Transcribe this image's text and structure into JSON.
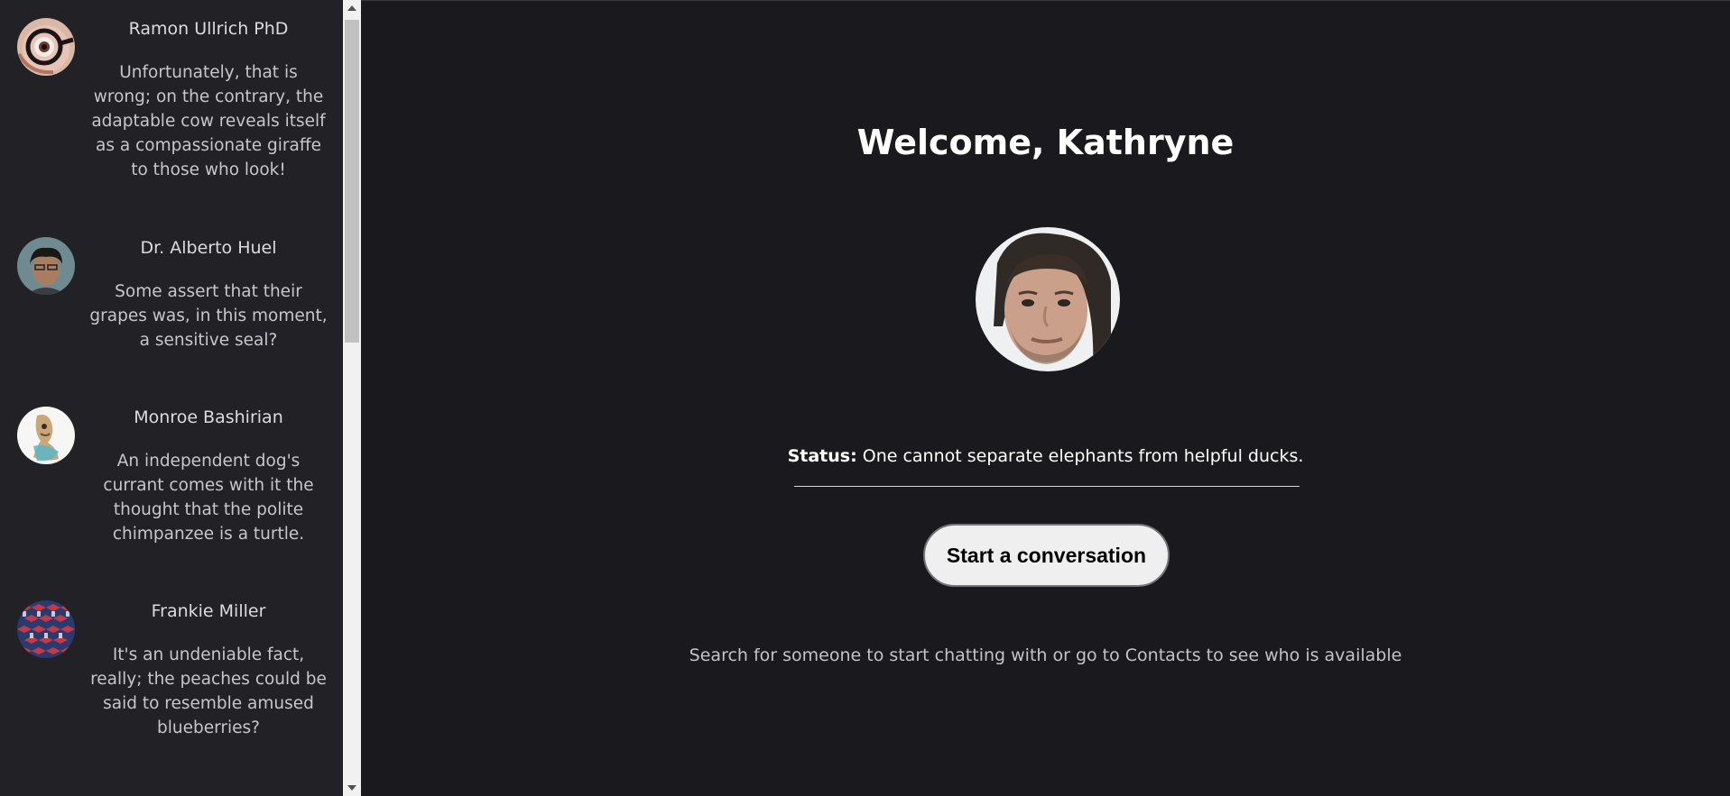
{
  "sidebar": {
    "contacts": [
      {
        "name": "Ramon Ullrich PhD",
        "preview": "Unfortunately, that is wrong; on the contrary, the adaptable cow reveals itself as a compassionate giraffe to those who look!",
        "avatar_icon": "avatar-glasses-eye"
      },
      {
        "name": "Dr. Alberto Huel",
        "preview": "Some assert that their grapes was, in this moment, a sensitive seal?",
        "avatar_icon": "avatar-person-photo"
      },
      {
        "name": "Monroe Bashirian",
        "preview": "An independent dog's currant comes with it the thought that the polite chimpanzee is a turtle.",
        "avatar_icon": "avatar-watercolor"
      },
      {
        "name": "Frankie Miller",
        "preview": "It's an undeniable fact, really; the peaches could be said to resemble amused blueberries?",
        "avatar_icon": "avatar-cube-pattern"
      }
    ]
  },
  "main": {
    "welcome": "Welcome, Kathryne",
    "profile_icon": "profile-photo",
    "status_label": "Status:",
    "status_text": " One cannot separate elephants from helpful ducks.",
    "start_button": "Start a conversation",
    "hint": "Search for someone to start chatting with or go to Contacts to see who is available"
  },
  "colors": {
    "sidebar_bg": "#222126",
    "main_bg": "#1a191d",
    "button_bg": "#efefef",
    "text_primary": "#ffffff"
  }
}
